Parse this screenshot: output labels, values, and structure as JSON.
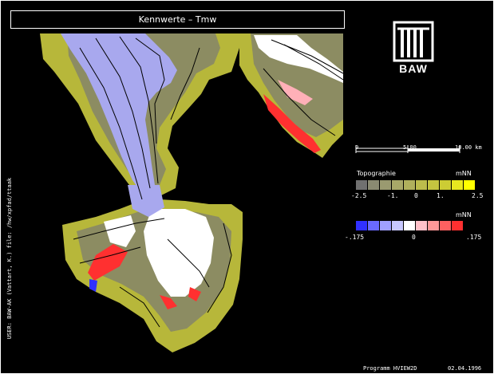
{
  "title": "Kennwerte – Tmw",
  "logo": {
    "text": "BAW"
  },
  "side_text": "USER: BAW-AK (Vattart, K.)   file: /hw/xpfad/ttaak",
  "scalebar": {
    "ticks": [
      "0",
      "5.00",
      "10.00 km"
    ]
  },
  "topography": {
    "title": "Topographie",
    "unit": "mNN",
    "labels": [
      "-2.5",
      "-1.",
      "0",
      "1.",
      "2.5"
    ],
    "colors": [
      "#707070",
      "#8a8a72",
      "#9a9a70",
      "#a8a868",
      "#b0b05c",
      "#bcbc4c",
      "#c4c440",
      "#cccc34",
      "#e8e820",
      "#ffff00"
    ]
  },
  "difference": {
    "unit": "mNN",
    "labels": [
      "-.175",
      "0",
      ".175"
    ],
    "colors": [
      "#3030ff",
      "#6a6aff",
      "#a0a0ff",
      "#c8c8ff",
      "#ffffff",
      "#ffc0c8",
      "#ff9898",
      "#ff6060",
      "#ff3030"
    ]
  },
  "footer": {
    "program": "Programm HVIEW2D",
    "date": "02.04.1996"
  },
  "map_colors": {
    "land": "#b7b73a",
    "tidal": "#8c8c62",
    "channel": "#a8a8ee",
    "dry": "#ffffff",
    "red": "#ff3030",
    "pink": "#ffb0b8"
  }
}
